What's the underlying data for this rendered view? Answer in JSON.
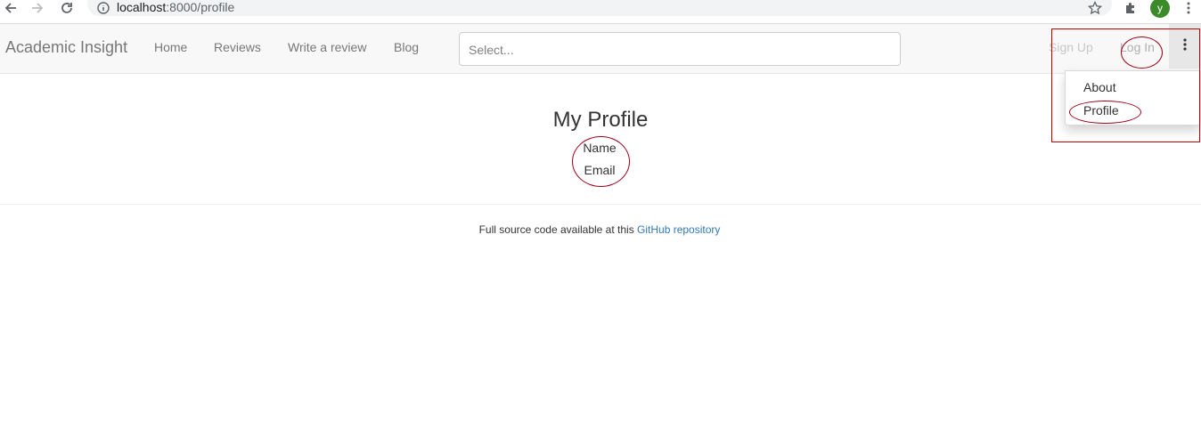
{
  "browser": {
    "url_host": "localhost",
    "url_path": ":8000/profile",
    "avatar_letter": "y"
  },
  "navbar": {
    "brand": "Academic Insight",
    "links": [
      "Home",
      "Reviews",
      "Write a review",
      "Blog"
    ],
    "search_placeholder": "Select...",
    "signup": "Sign Up",
    "login": "Log In"
  },
  "dropdown": {
    "items": [
      "About",
      "Profile"
    ]
  },
  "main": {
    "title": "My Profile",
    "fields": [
      "Name",
      "Email"
    ]
  },
  "footer": {
    "text": "Full source code available at this ",
    "link": "GitHub repository"
  },
  "colors": {
    "annotation": "#c00000",
    "link": "#337ab7",
    "avatar_bg": "#3c8b2a"
  },
  "icons": [
    "back-arrow-icon",
    "forward-arrow-icon",
    "reload-icon",
    "info-icon",
    "star-icon",
    "extension-puzzle-icon",
    "kebab-menu-icon"
  ]
}
